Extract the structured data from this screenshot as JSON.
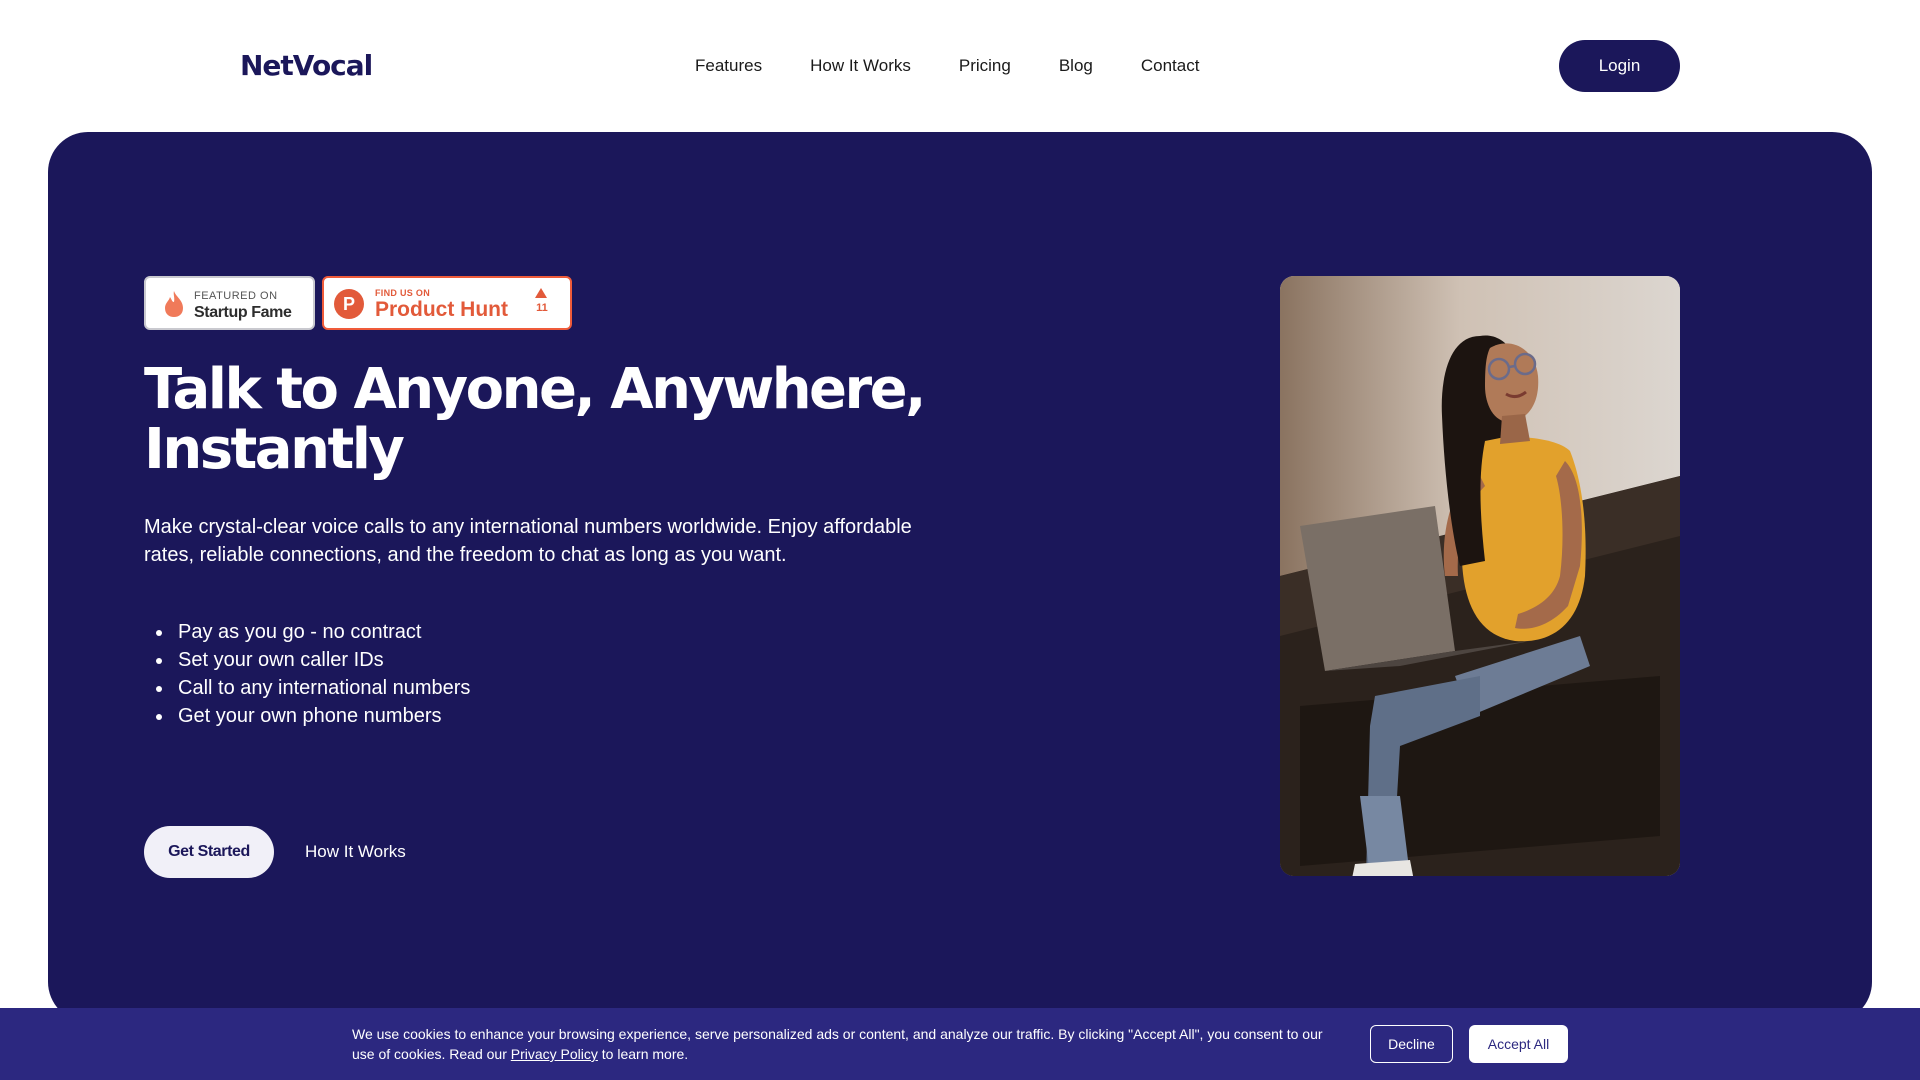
{
  "header": {
    "logo": "NetVocal",
    "nav": [
      "Features",
      "How It Works",
      "Pricing",
      "Blog",
      "Contact"
    ],
    "login_label": "Login"
  },
  "badges": {
    "startup_fame": {
      "small": "FEATURED ON",
      "big": "Startup Fame"
    },
    "product_hunt": {
      "letter": "P",
      "small": "FIND US ON",
      "big": "Product Hunt",
      "count": "11"
    }
  },
  "hero": {
    "headline_line1": "Talk to Anyone, Anywhere,",
    "headline_line2": "Instantly",
    "subtext": "Make crystal-clear voice calls to any international numbers worldwide. Enjoy affordable rates, reliable connections, and the freedom to chat as long as you want.",
    "features": [
      "Pay as you go - no contract",
      "Set your own caller IDs",
      "Call to any international numbers",
      "Get your own phone numbers"
    ],
    "cta_primary": "Get Started",
    "cta_secondary": "How It Works"
  },
  "cookie": {
    "text_before_link": "We use cookies to enhance your browsing experience, serve personalized ads or content, and analyze our traffic. By clicking \"Accept All\", you consent to our use of cookies. Read our ",
    "link_label": "Privacy Policy",
    "text_after_link": " to learn more.",
    "decline_label": "Decline",
    "accept_label": "Accept All"
  },
  "colors": {
    "brand_navy": "#1b175a",
    "cookie_bg": "#2c2880",
    "product_hunt_orange": "#e25a3a"
  },
  "icons": {
    "startup_fame": "flame-icon",
    "product_hunt": "product-hunt-logo-icon",
    "upvote": "upvote-arrow-icon"
  }
}
